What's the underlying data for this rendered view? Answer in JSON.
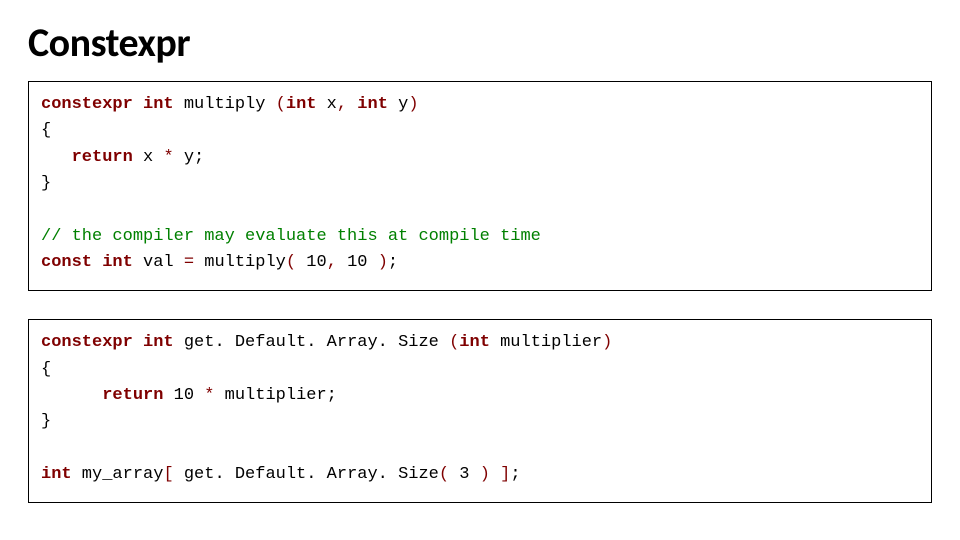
{
  "title": "Constexpr",
  "code1": {
    "line1_kw1": "constexpr",
    "line1_kw2": "int",
    "line1_fn": " multiply ",
    "line1_paren_open": "(",
    "line1_kw3": "int",
    "line1_p1": " x",
    "line1_comma": ",",
    "line1_sp": " ",
    "line1_kw4": "int",
    "line1_p2": " y",
    "line1_paren_close": ")",
    "line2": "{",
    "line3_indent": "   ",
    "line3_kw": "return",
    "line3_expr": " x ",
    "line3_op": "*",
    "line3_rest": " y;",
    "line4": "}",
    "line5": "",
    "line6_cm": "// the compiler may evaluate this at compile time",
    "line7_kw1": "const",
    "line7_sp1": " ",
    "line7_kw2": "int",
    "line7_var": " val ",
    "line7_eq": "=",
    "line7_call": " multiply",
    "line7_po": "(",
    "line7_a1": " 10",
    "line7_c": ",",
    "line7_a2": " 10 ",
    "line7_pc": ")",
    "line7_semi": ";"
  },
  "code2": {
    "line1_kw1": "constexpr",
    "line1_kw2": "int",
    "line1_fn": " get. Default. Array. Size ",
    "line1_po": "(",
    "line1_kw3": "int",
    "line1_p1": " multiplier",
    "line1_pc": ")",
    "line2": "{",
    "line3_indent": "      ",
    "line3_kw": "return",
    "line3_sp": " ",
    "line3_n": "10",
    "line3_sp2": " ",
    "line3_op": "*",
    "line3_rest": " multiplier;",
    "line4": "}",
    "line5": "",
    "line6_kw": "int",
    "line6_var": " my_array",
    "line6_bo": "[",
    "line6_call": " get. Default. Array. Size",
    "line6_po": "(",
    "line6_a": " 3 ",
    "line6_pc": ")",
    "line6_sp": " ",
    "line6_bc": "]",
    "line6_semi": ";"
  }
}
